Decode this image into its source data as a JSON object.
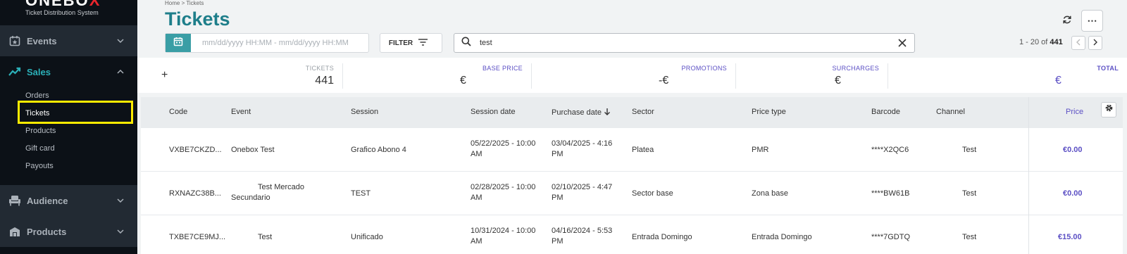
{
  "sidebar": {
    "logo_word_main": "ONEBO",
    "logo_word_accent": "X",
    "logo_subtitle": "Ticket Distribution System",
    "groups": {
      "events": "Events",
      "sales": "Sales",
      "audience": "Audience",
      "products": "Products"
    },
    "sales_items": [
      "Orders",
      "Tickets",
      "Products",
      "Gift card",
      "Payouts"
    ]
  },
  "header": {
    "breadcrumb": "Home > Tickets",
    "title": "Tickets",
    "date_placeholder": "mm/dd/yyyy HH:MM  -  mm/dd/yyyy HH:MM",
    "filter_label": "FILTER",
    "search_value": "test",
    "pager_prefix": "1 - 20 of",
    "pager_total": "441",
    "more_label": "⋯"
  },
  "summary": {
    "tickets_label": "TICKETS",
    "tickets_value": "441",
    "base_price_label": "BASE PRICE",
    "base_price_value": "€",
    "promotions_label": "PROMOTIONS",
    "promotions_value": "-€",
    "surcharges_label": "SURCHARGES",
    "surcharges_value": "€",
    "total_label": "TOTAL",
    "total_value": "€"
  },
  "table": {
    "columns": {
      "code": "Code",
      "event": "Event",
      "session": "Session",
      "session_date": "Session date",
      "purchase_date": "Purchase date",
      "sector": "Sector",
      "price_type": "Price type",
      "barcode": "Barcode",
      "channel": "Channel",
      "price": "Price"
    },
    "rows": [
      {
        "code": "VXBE7CKZD...",
        "event": "Onebox Test",
        "session": "Grafico Abono 4",
        "session_date_1": "05/22/2025 - 10:00",
        "session_date_2": "AM",
        "purchase_date_1": "03/04/2025 - 4:16",
        "purchase_date_2": "PM",
        "sector": "Platea",
        "price_type": "PMR",
        "barcode": "****X2QC6",
        "channel": "Test",
        "price": "€0.00"
      },
      {
        "code": "RXNAZC38B...",
        "event_1": "Test Mercado",
        "event_2": "Secundario",
        "session": "TEST",
        "session_date_1": "02/28/2025 - 10:00",
        "session_date_2": "AM",
        "purchase_date_1": "02/10/2025 - 4:47",
        "purchase_date_2": "PM",
        "sector": "Sector base",
        "price_type": "Zona base",
        "barcode": "****BW61B",
        "channel": "Test",
        "price": "€0.00"
      },
      {
        "code": "TXBE7CE9MJ...",
        "event": "Test",
        "session": "Unificado",
        "session_date_1": "10/31/2024 - 10:00",
        "session_date_2": "AM",
        "purchase_date_1": "04/16/2024 - 5:53",
        "purchase_date_2": "PM",
        "sector": "Entrada Domingo",
        "price_type": "Entrada Domingo",
        "barcode": "****7GDTQ",
        "channel": "Test",
        "price": "€15.00"
      }
    ]
  },
  "colors": {
    "accent": "#1e7e8a",
    "price": "#5b4fc4",
    "sidebar_bg": "#0c1117",
    "highlight": "#ffeb00"
  },
  "icons": [
    "calendar-icon",
    "filter-lines-icon",
    "search-icon",
    "close-icon",
    "refresh-icon",
    "more-icon",
    "gear-icon",
    "star-calendar-icon",
    "trend-up-icon",
    "chair-icon",
    "box-icon",
    "chevron-down-icon",
    "chevron-up-icon",
    "sort-down-icon",
    "plus-icon"
  ]
}
